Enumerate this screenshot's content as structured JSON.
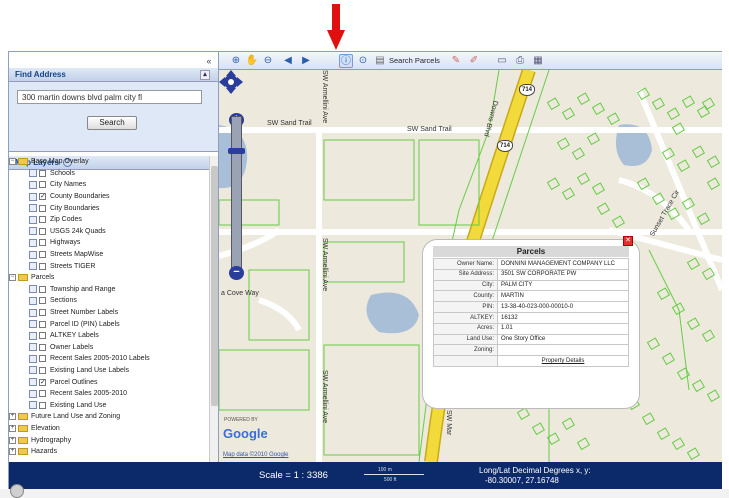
{
  "find_address": {
    "title": "Find Address",
    "input_value": "300 martin downs blvd palm city fl",
    "search_label": "Search"
  },
  "map_layers": {
    "title": "Map Layers",
    "groups": [
      {
        "label": "Base Map Overlay",
        "expanded": true,
        "items": [
          {
            "label": "Schools",
            "checked": false
          },
          {
            "label": "City Names",
            "checked": false
          },
          {
            "label": "County Boundaries",
            "checked": true
          },
          {
            "label": "City Boundaries",
            "checked": false
          },
          {
            "label": "Zip Codes",
            "checked": false
          },
          {
            "label": "USGS 24k Quads",
            "checked": false
          },
          {
            "label": "Highways",
            "checked": false
          },
          {
            "label": "Streets MapWise",
            "checked": false
          },
          {
            "label": "Streets TIGER",
            "checked": false
          }
        ]
      },
      {
        "label": "Parcels",
        "expanded": true,
        "items": [
          {
            "label": "Township and Range",
            "checked": false
          },
          {
            "label": "Sections",
            "checked": false
          },
          {
            "label": "Street Number Labels",
            "checked": false
          },
          {
            "label": "Parcel ID (PIN) Labels",
            "checked": false
          },
          {
            "label": "ALTKEY Labels",
            "checked": false
          },
          {
            "label": "Owner Labels",
            "checked": false
          },
          {
            "label": "Recent Sales 2005-2010 Labels",
            "checked": false
          },
          {
            "label": "Existing Land Use Labels",
            "checked": false
          },
          {
            "label": "Parcel Outlines",
            "checked": true
          },
          {
            "label": "Recent Sales 2005-2010",
            "checked": false
          },
          {
            "label": "Existing Land Use",
            "checked": false
          }
        ]
      },
      {
        "label": "Future Land Use and Zoning",
        "expanded": false,
        "items": []
      },
      {
        "label": "Elevation",
        "expanded": false,
        "items": []
      },
      {
        "label": "Hydrography",
        "expanded": false,
        "items": []
      },
      {
        "label": "Hazards",
        "expanded": false,
        "items": []
      }
    ]
  },
  "toolbar": {
    "search_parcels_label": "Search Parcels",
    "icons": [
      "zoom-in-icon",
      "pan-hand-icon",
      "zoom-out-icon",
      "back-arrow-icon",
      "forward-arrow-icon",
      "identify-icon",
      "zoom-extent-icon",
      "search-parcels-icon",
      "measure-icon",
      "measure-area-icon",
      "window-icon",
      "print-icon",
      "export-icon"
    ]
  },
  "map": {
    "road_labels": {
      "sw_sand_trail_1": "SW Sand Trail",
      "sw_sand_trail_2": "SW Sand Trail",
      "downs_blvd": "Downs Blvd",
      "sw_armellini_1": "SW Armellini Ave",
      "sw_armellini_2": "SW Armellini Ave",
      "sw_armellini_3": "SW Armellini Ave",
      "cove_way": "a Cove Way",
      "sw_mar": "SW Mar",
      "sunset_trace": "Sunset Trace Cir"
    },
    "shields": [
      "714",
      "714"
    ],
    "powered_by": "POWERED BY",
    "google": "Google",
    "map_data": "Map data ©2010 Google",
    "colors": {
      "parcel_outline": "#66cc44",
      "highway": "#f2da3a",
      "water": "#a9bfd8"
    }
  },
  "popup": {
    "title": "Parcels",
    "fields": [
      {
        "key": "Owner Name:",
        "value": "DONNINI MANAGEMENT COMPANY LLC"
      },
      {
        "key": "Site Address:",
        "value": "3501 SW CORPORATE PW"
      },
      {
        "key": "City:",
        "value": "PALM CITY"
      },
      {
        "key": "County:",
        "value": "MARTIN"
      },
      {
        "key": "PIN:",
        "value": "13-38-40-023-000-00010-0"
      },
      {
        "key": "ALTKEY:",
        "value": "16132"
      },
      {
        "key": "Acres:",
        "value": "1.01"
      },
      {
        "key": "Land Use:",
        "value": "One Story Office"
      },
      {
        "key": "Zoning:",
        "value": ""
      }
    ],
    "link": "Property Details"
  },
  "status": {
    "scale_text": "Scale = 1 : 3386",
    "scalebar_top": "100 m",
    "scalebar_bottom": "500 ft",
    "coords_label": "Long/Lat Decimal Degrees x, y:",
    "coords_value": "-80.30007, 27.16748"
  }
}
